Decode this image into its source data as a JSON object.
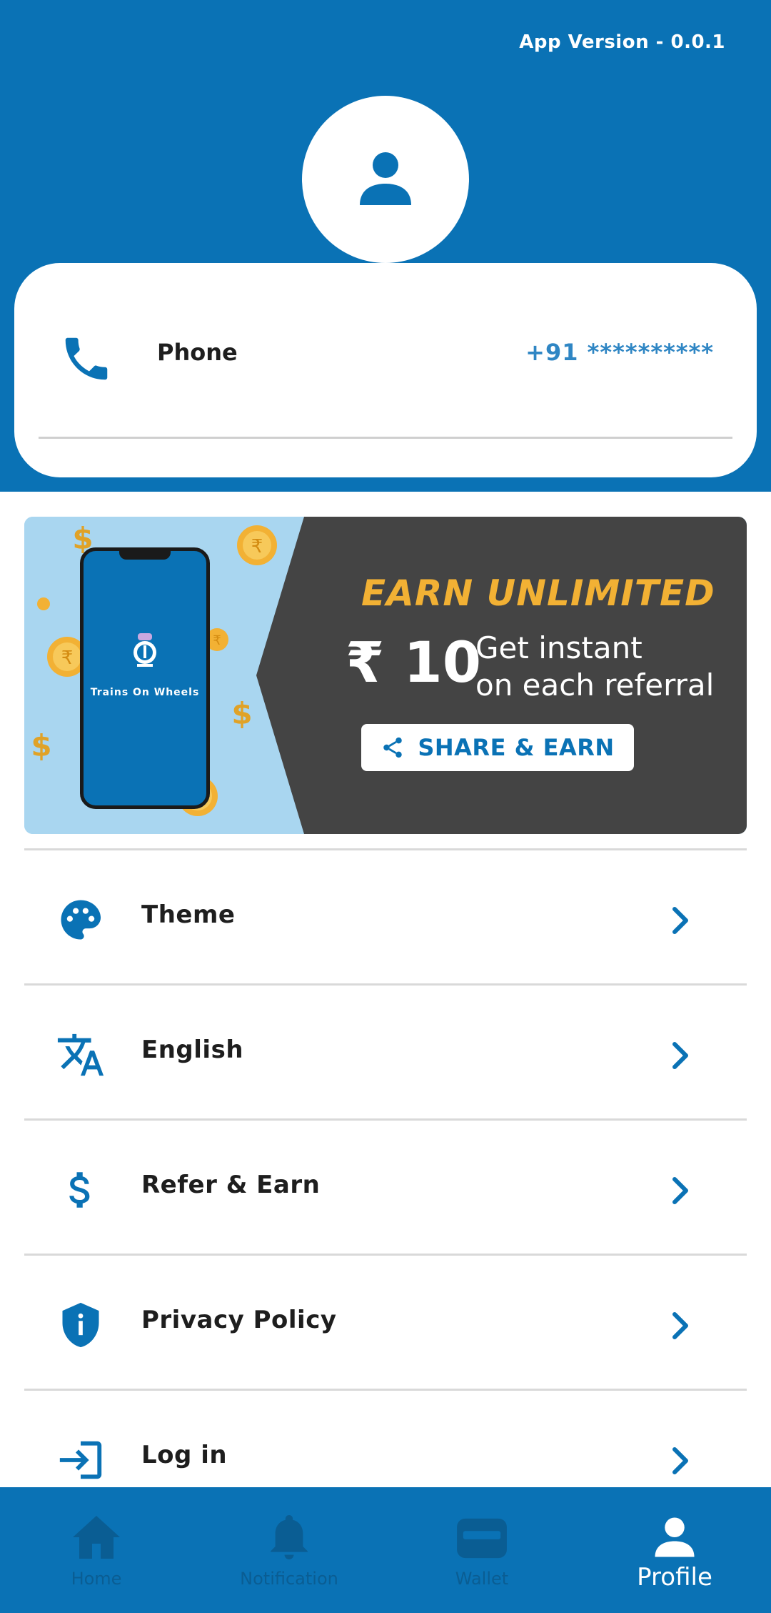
{
  "header": {
    "app_version": "App Version - 0.0.1"
  },
  "profile": {
    "phone_label": "Phone",
    "phone_value": "+91 **********"
  },
  "banner": {
    "title": "EARN UNLIMITED",
    "amount": "₹ 10",
    "instant_line1": "Get instant",
    "instant_line2": "on each referral",
    "share_button": "SHARE & EARN",
    "app_name": "Trains On Wheels"
  },
  "menu": {
    "items": [
      {
        "label": "Theme",
        "icon": "palette-icon"
      },
      {
        "label": "English",
        "icon": "translate-icon"
      },
      {
        "label": "Refer & Earn",
        "icon": "dollar-icon"
      },
      {
        "label": "Privacy Policy",
        "icon": "shield-info-icon"
      },
      {
        "label": "Log in",
        "icon": "login-icon"
      }
    ]
  },
  "bottom_nav": {
    "items": [
      {
        "label": "Home",
        "icon": "home-icon",
        "active": false
      },
      {
        "label": "Notification",
        "icon": "bell-icon",
        "active": false
      },
      {
        "label": "Wallet",
        "icon": "wallet-icon",
        "active": false
      },
      {
        "label": "Profile",
        "icon": "person-icon",
        "active": true
      }
    ]
  },
  "colors": {
    "primary": "#0a72b5",
    "accent_gold": "#f2b134",
    "banner_dark": "#444444",
    "banner_light": "#a9d6f0"
  }
}
